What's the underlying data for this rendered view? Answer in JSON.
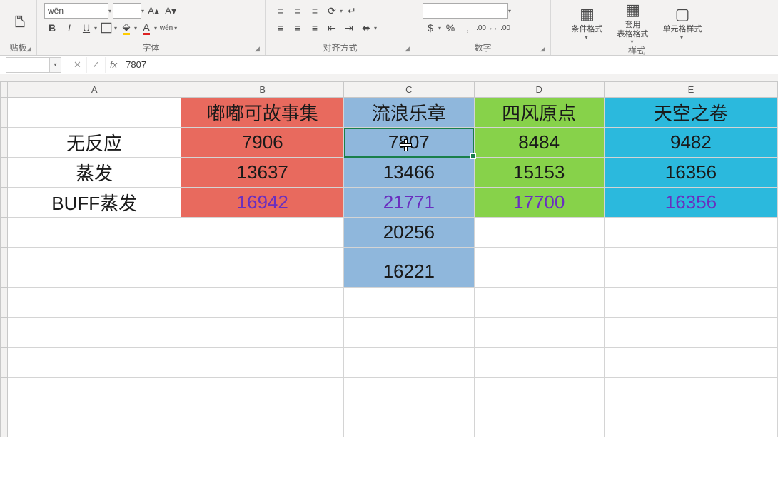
{
  "ribbon": {
    "group_clipboard": "贴板",
    "group_font": "字体",
    "group_alignment": "对齐方式",
    "group_number": "数字",
    "group_styles": "样式",
    "font_name": "wēn",
    "font_size": "",
    "bold": "B",
    "italic": "I",
    "underline": "U",
    "cond_format": "条件格式",
    "table_format": "套用\n表格格式",
    "cell_styles": "单元格样式"
  },
  "chart_data": {
    "type": "table",
    "title": "",
    "columns": [
      "",
      "嘟嘟可故事集",
      "流浪乐章",
      "四风原点",
      "天空之卷"
    ],
    "rows": [
      {
        "label": "无反应",
        "values": [
          7906,
          7807,
          8484,
          9482
        ]
      },
      {
        "label": "蒸发",
        "values": [
          13637,
          13466,
          15153,
          16356
        ]
      },
      {
        "label": "BUFF蒸发",
        "values": [
          16942,
          21771,
          17700,
          16356
        ]
      }
    ],
    "extra_C": [
      20256,
      16221
    ]
  },
  "formula_bar": {
    "name_box": "",
    "value": "7807"
  },
  "col_headers": {
    "A": "A",
    "B": "B",
    "C": "C",
    "D": "D",
    "E": "E"
  },
  "headers": {
    "B": "嘟嘟可故事集",
    "C": "流浪乐章",
    "D": "四风原点",
    "E": "天空之卷"
  },
  "rows": {
    "r1": {
      "A": "无反应",
      "B": "7906",
      "C": "7807",
      "D": "8484",
      "E": "9482"
    },
    "r2": {
      "A": "蒸发",
      "B": "13637",
      "C": "13466",
      "D": "15153",
      "E": "16356"
    },
    "r3": {
      "A": "BUFF蒸发",
      "B": "16942",
      "C": "21771",
      "D": "17700",
      "E": "16356"
    },
    "r4": {
      "C": "20256"
    },
    "r5": {
      "C": "16221"
    }
  }
}
